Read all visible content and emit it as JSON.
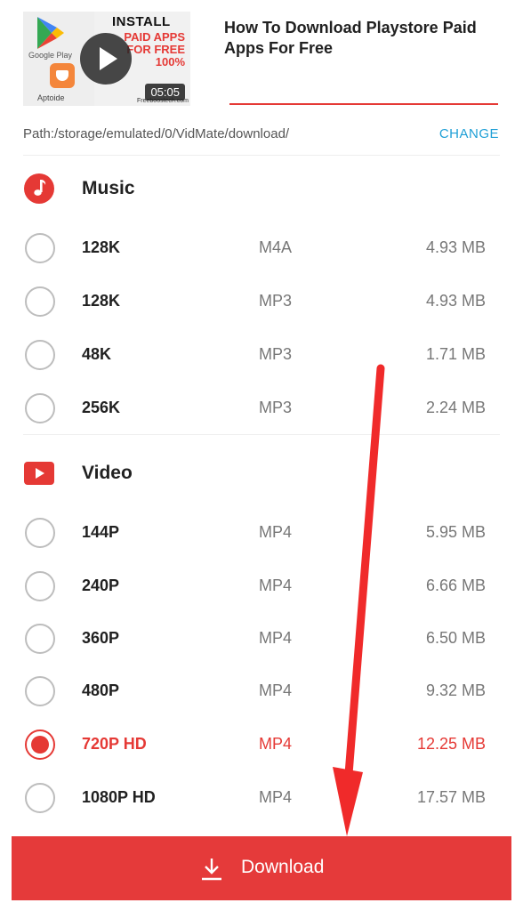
{
  "header": {
    "video_title": "How To Download Playstore Paid Apps For Free",
    "thumbnail": {
      "headline": "INSTALL",
      "subheadline": "PAID APPS FOR FREE 100%",
      "left_label_top": "Google Play",
      "left_label_bottom": "Aptoide",
      "site": "Freeboostech.com",
      "duration": "05:05"
    }
  },
  "path": {
    "text": "Path:/storage/emulated/0/VidMate/download/",
    "change_label": "CHANGE"
  },
  "music": {
    "label": "Music",
    "icon": "music-note-icon",
    "options": [
      {
        "quality": "128K",
        "format": "M4A",
        "size": "4.93 MB",
        "selected": false
      },
      {
        "quality": "128K",
        "format": "MP3",
        "size": "4.93 MB",
        "selected": false
      },
      {
        "quality": "48K",
        "format": "MP3",
        "size": "1.71 MB",
        "selected": false
      },
      {
        "quality": "256K",
        "format": "MP3",
        "size": "2.24 MB",
        "selected": false
      }
    ]
  },
  "video": {
    "label": "Video",
    "icon": "play-icon",
    "options": [
      {
        "quality": "144P",
        "format": "MP4",
        "size": "5.95 MB",
        "selected": false
      },
      {
        "quality": "240P",
        "format": "MP4",
        "size": "6.66 MB",
        "selected": false
      },
      {
        "quality": "360P",
        "format": "MP4",
        "size": "6.50 MB",
        "selected": false
      },
      {
        "quality": "480P",
        "format": "MP4",
        "size": "9.32 MB",
        "selected": false
      },
      {
        "quality": "720P HD",
        "format": "MP4",
        "size": "12.25 MB",
        "selected": true
      },
      {
        "quality": "1080P HD",
        "format": "MP4",
        "size": "17.57 MB",
        "selected": false
      }
    ]
  },
  "download": {
    "label": "Download",
    "icon": "download-icon"
  },
  "colors": {
    "accent": "#e53935",
    "link": "#1e9fd6",
    "download_bar": "#e53a3a"
  }
}
